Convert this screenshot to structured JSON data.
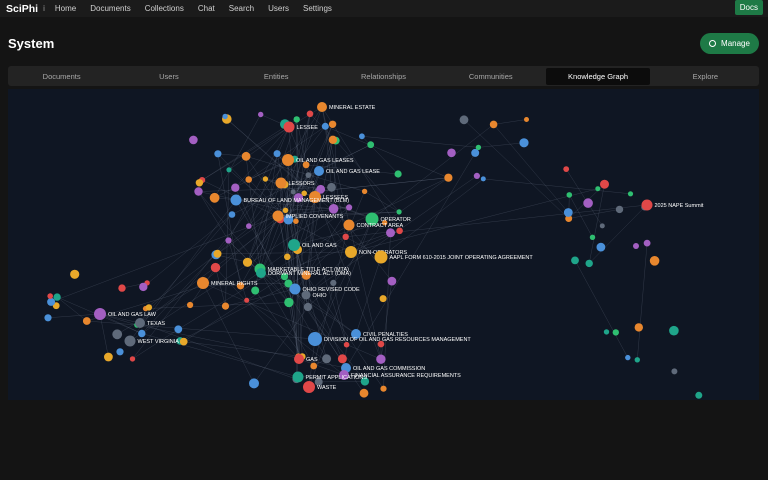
{
  "app": {
    "brand": "SciPhi",
    "brand_sep": "i"
  },
  "nav": {
    "items": [
      "Home",
      "Documents",
      "Collections",
      "Chat",
      "Search",
      "Users",
      "Settings"
    ]
  },
  "header": {
    "docs_label": "Docs",
    "title": "System",
    "manage_label": "Manage"
  },
  "tabs": {
    "items": [
      "Documents",
      "Users",
      "Entities",
      "Relationships",
      "Communities",
      "Knowledge Graph",
      "Explore"
    ],
    "active": "Knowledge Graph"
  },
  "colors": {
    "blue": "#4a90d9",
    "orange": "#e8872e",
    "red": "#e04848",
    "green": "#2fbf71",
    "teal": "#1fa58a",
    "purple": "#a35fc2",
    "gray": "#5f6a7a",
    "yellow": "#e8a82a",
    "accent": "#1e7a46"
  },
  "graph": {
    "nodes": [
      {
        "label": "MINERAL ESTATE",
        "c": "orange"
      },
      {
        "label": "LESSEE",
        "c": "red"
      },
      {
        "label": "OIL AND GAS LEASES",
        "c": "orange"
      },
      {
        "label": "OIL AND GAS LEASE",
        "c": "blue"
      },
      {
        "label": "LESSORS",
        "c": "orange"
      },
      {
        "label": "LESSEES",
        "c": "orange"
      },
      {
        "label": "BUREAU OF LAND MANAGEMENT (BLM)",
        "c": "blue"
      },
      {
        "label": "IMPLIED COVENANTS",
        "c": "orange"
      },
      {
        "label": "OPERATOR",
        "c": "green"
      },
      {
        "label": "CONTRACT AREA",
        "c": "orange"
      },
      {
        "label": "OIL AND GAS",
        "c": "teal"
      },
      {
        "label": "NON-OPERATORS",
        "c": "yellow"
      },
      {
        "label": "AAPL FORM 610-2015 JOINT OPERATING AGREEMENT",
        "c": "yellow"
      },
      {
        "label": "MARKETABLE TITLE ACT (MTA)",
        "c": "green"
      },
      {
        "label": "DORMANT MINERAL ACT (DMA)",
        "c": "teal"
      },
      {
        "label": "MINERAL RIGHTS",
        "c": "orange"
      },
      {
        "label": "OHIO REVISED CODE",
        "c": "blue"
      },
      {
        "label": "OHIO",
        "c": "gray"
      },
      {
        "label": "OIL AND GAS LAW",
        "c": "purple"
      },
      {
        "label": "TEXAS",
        "c": "gray"
      },
      {
        "label": "WEST VIRGINIA",
        "c": "gray"
      },
      {
        "label": "CIVIL PENALTIES",
        "c": "blue"
      },
      {
        "label": "DIVISION OF OIL AND GAS RESOURCES MANAGEMENT",
        "c": "blue"
      },
      {
        "label": "GAS",
        "c": "red"
      },
      {
        "label": "OIL AND GAS COMMISSION",
        "c": "blue"
      },
      {
        "label": "FINANCIAL ASSURANCE REQUIREMENTS",
        "c": "purple"
      },
      {
        "label": "PERMIT APPLICATIONS",
        "c": "teal"
      },
      {
        "label": "WASTE",
        "c": "red"
      },
      {
        "label": "2025 NAPE Summit",
        "c": "red"
      }
    ]
  }
}
